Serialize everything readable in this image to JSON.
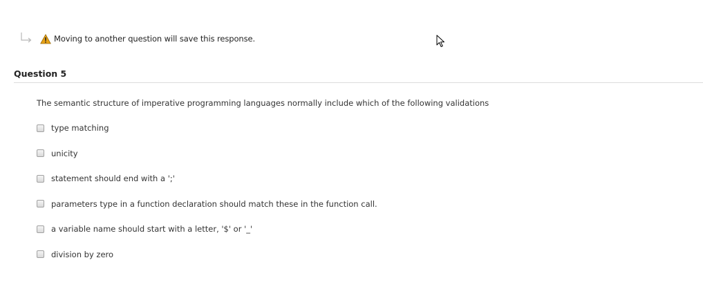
{
  "notice": {
    "text": "Moving to another question will save this response."
  },
  "question": {
    "title": "Question 5",
    "text": "The semantic structure of imperative programming languages normally include which of the following validations",
    "options": [
      {
        "label": "type matching",
        "checked": false
      },
      {
        "label": "unicity",
        "checked": false
      },
      {
        "label": "statement should end with a ';'",
        "checked": false
      },
      {
        "label": "parameters type in a function declaration should match these in the function call.",
        "checked": false
      },
      {
        "label": "a variable name should start with a letter, '$' or '_'",
        "checked": false
      },
      {
        "label": "division by zero",
        "checked": false
      }
    ]
  },
  "colors": {
    "warning": "#e8a317",
    "rule": "#dcdcdc"
  },
  "icons": {
    "return": "return-arrow-icon",
    "warning": "warning-icon",
    "cursor": "mouse-cursor-icon"
  }
}
